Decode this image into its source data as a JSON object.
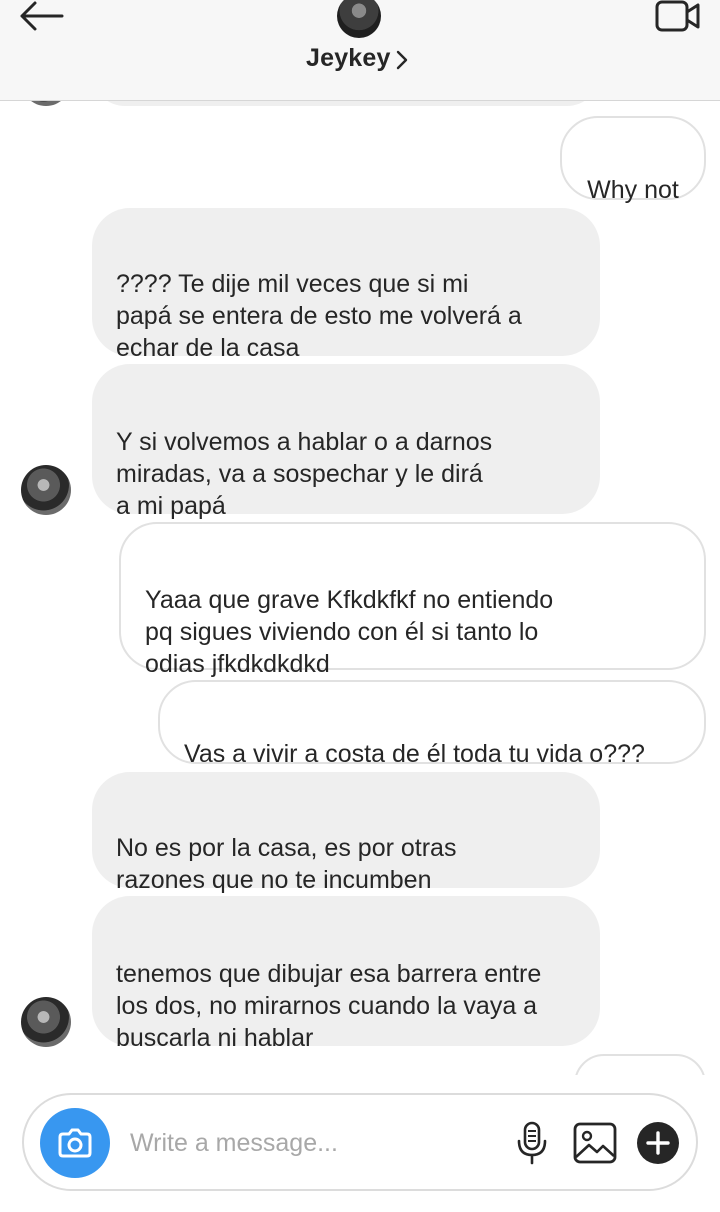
{
  "header": {
    "contact_name": "Jeykey",
    "icons": {
      "back": "arrow-left-icon",
      "video": "video-camera-icon",
      "chevron": "chevron-right-icon"
    }
  },
  "messages": [
    {
      "direction": "outgoing",
      "text": "Why not"
    },
    {
      "direction": "incoming",
      "text": "???? Te dije mil veces que si mi\npapá se entera de esto me volverá a\nechar de la casa"
    },
    {
      "direction": "incoming",
      "text": "Y si volvemos a hablar o a darnos\nmiradas, va a sospechar y le dirá\na mi papá"
    },
    {
      "direction": "outgoing",
      "text": "Yaaa que grave Kfkdkfkf no entiendo\npq sigues viviendo con él si tanto lo\nodias jfkdkdkdkd"
    },
    {
      "direction": "outgoing",
      "text": "Vas a vivir a costa de él toda tu vida o???"
    },
    {
      "direction": "incoming",
      "text": "No es por la casa, es por otras\nrazones que no te incumben"
    },
    {
      "direction": "incoming",
      "text": "tenemos que dibujar esa barrera entre\nlos dos, no mirarnos cuando la vaya a\nbuscarla ni hablar"
    }
  ],
  "composer": {
    "placeholder": "Write a message...",
    "icons": {
      "camera": "camera-icon",
      "mic": "microphone-icon",
      "gallery": "image-icon",
      "add": "plus-icon"
    },
    "accent_color": "#3897f0"
  },
  "colors": {
    "incoming_bubble": "#efefef",
    "outgoing_border": "#e1e1e1",
    "header_bg": "#f7f7f7"
  }
}
